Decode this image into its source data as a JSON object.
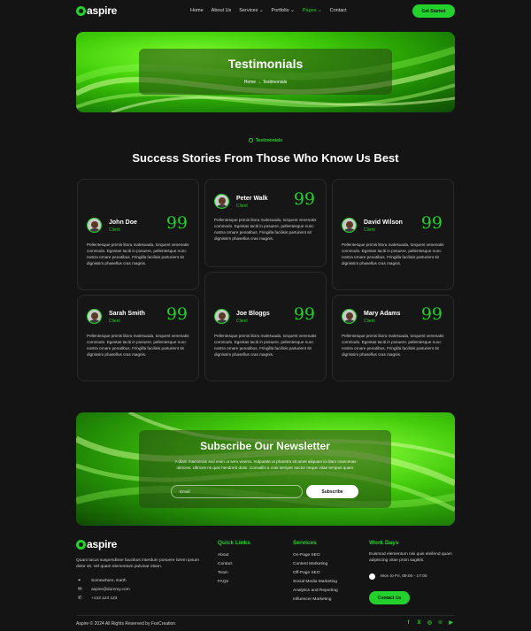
{
  "nav": {
    "logo": "aspire",
    "items": [
      {
        "label": "Home"
      },
      {
        "label": "About Us"
      },
      {
        "label": "Services ⌄"
      },
      {
        "label": "Portfolio ⌄"
      },
      {
        "label": "Pages ⌄"
      },
      {
        "label": "Contact"
      }
    ],
    "cta": "Get Started",
    "accent": "#22d12b"
  },
  "hero": {
    "title": "Testimonials",
    "breadcrumb": "Home  →  Testimonials"
  },
  "testimonials": {
    "eyebrow": "Testimonials",
    "title": "Success Stories From Those Who Know Us Best",
    "quote_mark": "99",
    "cards": [
      {
        "name": "John Doe",
        "role": "Client",
        "text": "Pellentesque primis litora malesuada, torquent venenatis commodo. Egestas taciti in posuere, pellentesque nunc nostra ornare penatibus. Fringilla facilisis parturient sit dignissim phasellus cras magnis."
      },
      {
        "name": "Peter Walk",
        "role": "Client",
        "text": "Pellentesque primis litora malesuada, torquent venenatis commodo. Egestas taciti in posuere, pellentesque nunc nostra ornare penatibus. Fringilla facilisis parturient sit dignissim phasellus cras magnis."
      },
      {
        "name": "David Wilson",
        "role": "Client",
        "text": "Pellentesque primis litora malesuada, torquent venenatis commodo. Egestas taciti in posuere, pellentesque nunc nostra ornare penatibus. Fringilla facilisis parturient sit dignissim phasellus cras magnis."
      },
      {
        "name": "Sarah Smith",
        "role": "Client",
        "text": "Pellentesque primis litora malesuada, torquent venenatis commodo. Egestas taciti in posuere, pellentesque nunc nostra ornare penatibus. Fringilla facilisis parturient sit dignissim phasellus cras magnis."
      },
      {
        "name": "Joe Bloggs",
        "role": "Client",
        "text": "Pellentesque primis litora malesuada, torquent venenatis commodo. Egestas taciti in posuere, pellentesque nunc nostra ornare penatibus. Fringilla facilisis parturient sit dignissim phasellus cras magnis."
      },
      {
        "name": "Mary Adams",
        "role": "Client",
        "text": "Pellentesque primis litora malesuada, torquent venenatis commodo. Egestas taciti in posuere, pellentesque nunc nostra ornare penatibus. Fringilla facilisis parturient sit dignissim phasellus cras magnis."
      }
    ]
  },
  "newsletter": {
    "title": "Subscribe Our Newsletter",
    "text": "A diam maecenas sed enim ut sem viverra. Vulputate ut pharetra sit amet aliquam id diam maecenas ultricies. Ultrices mi quis hendrerit dolor. Convallis a cras semper auctor neque vitae tempus quam.",
    "input_placeholder": "Email",
    "button": "Subscribe"
  },
  "footer": {
    "logo": "aspire",
    "description": "Quam lacus suspendisse faucibus interdum posuere lorem ipsum dolor sit. Vel quam elementum pulvinar etiam.",
    "contacts": [
      {
        "icon": "location-pin-icon",
        "glyph": "⌖",
        "text": "Somewhere, Earth"
      },
      {
        "icon": "mail-icon",
        "glyph": "✉",
        "text": "aspire@dummy.com"
      },
      {
        "icon": "phone-icon",
        "glyph": "✆",
        "text": "+123 123 123"
      }
    ],
    "quick_links_title": "Quick Links",
    "quick_links": [
      "About",
      "Contact",
      "Team",
      "FAQs"
    ],
    "services_title": "Services",
    "services": [
      "On-Page SEO",
      "Content Marketing",
      "Off-Page SEO",
      "Social Media Marketing",
      "Analytics and Reporting",
      "Influencer Marketing"
    ],
    "workdays_title": "Work Days",
    "workdays_text": "Euismod elementum nisi quis eleifend quam adipiscing vitae proin sagittis.",
    "hours": "Mon to Fri, 09:00 - 17:00",
    "cta": "Contact Us",
    "copyright": "Aspire © 2024 All Rights Reserved by FoxCreation",
    "socials": [
      {
        "name": "facebook-icon",
        "glyph": "f"
      },
      {
        "name": "x-icon",
        "glyph": "X"
      },
      {
        "name": "instagram-icon",
        "glyph": "◎"
      },
      {
        "name": "pinterest-icon",
        "glyph": "℗"
      },
      {
        "name": "youtube-icon",
        "glyph": "▶"
      }
    ]
  }
}
